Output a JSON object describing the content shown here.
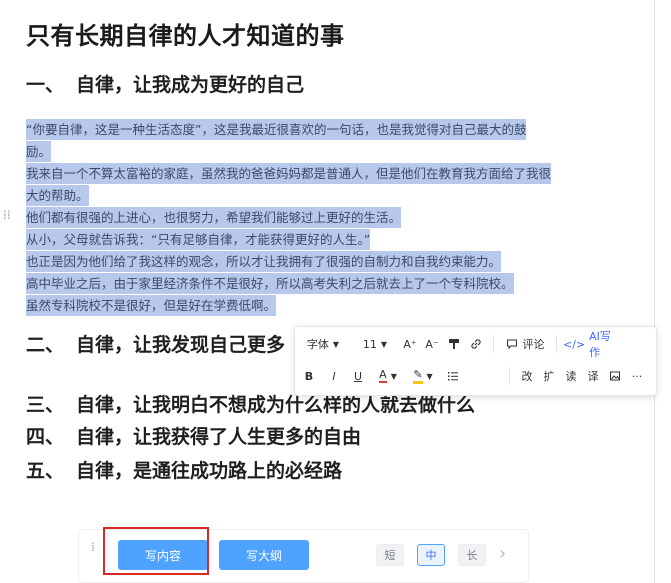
{
  "document": {
    "title": "只有长期自律的人才知道的事",
    "sections": [
      {
        "num": "一、",
        "text": "自律，让我成为更好的自己"
      },
      {
        "num": "二、",
        "text": "自律，让我发现自己更多"
      },
      {
        "num": "三、",
        "text": "自律，让我明白不想成为什么样的人就去做什么"
      },
      {
        "num": "四、",
        "text": "自律，让我获得了人生更多的自由"
      },
      {
        "num": "五、",
        "text": "自律，是通往成功路上的必经路"
      }
    ],
    "paragraph_lines": [
      "“你要自律，这是一种生活态度”，这是我最近很喜欢的一句话，也是我觉得对自己最大的鼓",
      "励。",
      "我来自一个不算太富裕的家庭，虽然我的爸爸妈妈都是普通人，但是他们在教育我方面给了我很",
      "大的帮助。",
      "他们都有很强的上进心，也很努力，希望我们能够过上更好的生活。",
      "从小，父母就告诉我：“只有足够自律，才能获得更好的人生。”",
      "也正是因为他们给了我这样的观念，所以才让我拥有了很强的自制力和自我约束能力。",
      "高中毕业之后，由于家里经济条件不是很好，所以高考失利之后就去上了一个专科院校。",
      "虽然专科院校不是很好，但是好在学费低啊。"
    ]
  },
  "toolbar": {
    "font_label": "字体",
    "font_size": "11",
    "grow_icon": "A⁺",
    "shrink_icon": "A⁻",
    "comment_label": "评论",
    "ai_label": "AI写作",
    "bold": "B",
    "italic": "I",
    "underline": "U",
    "font_color": "A",
    "more": "···",
    "actions": [
      "改",
      "扩",
      "读",
      "译"
    ]
  },
  "bottom_bar": {
    "write_content": "写内容",
    "write_outline": "写大纲",
    "lengths": [
      "短",
      "中",
      "长"
    ],
    "selected_length": "中"
  },
  "colors": {
    "selection": "#b8c8ec",
    "primary_button": "#4da3ff",
    "ai_accent": "#3b6cf6",
    "highlight_box": "#d92828"
  }
}
